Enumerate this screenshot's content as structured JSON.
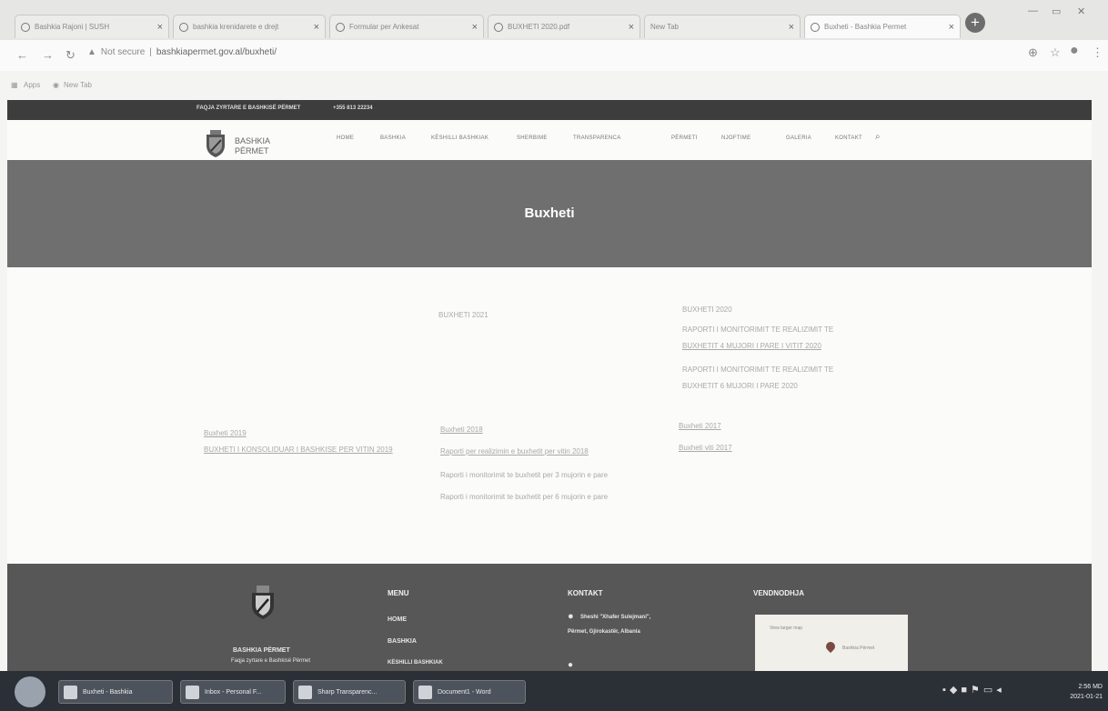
{
  "browser": {
    "tabs": [
      {
        "title": "Bashkia Rajoni | SUSH"
      },
      {
        "title": "bashkia krenidarete e drejt"
      },
      {
        "title": "Formular per Ankesat"
      },
      {
        "title": "BUXHETI 2020.pdf"
      },
      {
        "title": "New Tab"
      },
      {
        "title": "Buxheti - Bashkia Permet"
      }
    ],
    "new_tab": "+",
    "address": {
      "security": "Not secure",
      "url": "bashkiapermet.gov.al/buxheti/"
    },
    "bookmarks": [
      "Apps",
      "New Tab"
    ]
  },
  "site": {
    "topbar": {
      "org": "FAQJA ZYRTARE E BASHKISË PËRMET",
      "phone": "+355 813 22234"
    },
    "brand": {
      "line1": "BASHKIA",
      "line2": "PËRMET"
    },
    "nav": [
      "HOME",
      "BASHKIA",
      "KËSHILLI BASHKIAK",
      "SHERBIME",
      "TRANSPARENCA",
      "PËRMETI",
      "NJOFTIME",
      "GALERIA",
      "KONTAKT"
    ],
    "hero_title": "Buxheti",
    "content": {
      "col2_top": "BUXHETI 2021",
      "col3_top": "BUXHETI 2020",
      "col3_links": [
        "RAPORTI I MONITORIMIT TE REALIZIMIT TE",
        "BUXHETIT 4 MUJORI I PARE I VITIT 2020",
        "RAPORTI I MONITORIMIT TE REALIZIMIT TE",
        "BUXHETIT 6 MUJORI I PARE 2020"
      ],
      "col1_row": [
        "Buxheti 2019",
        "BUXHETI I KONSOLIDUAR I BASHKISE PER VITIN 2019"
      ],
      "col2_row": [
        "Buxheti 2018",
        "Raporti per realizimin e buxhetit per vitin 2018",
        "Raporti i monitorimit te buxhetit per 3 mujorin e pare",
        "Raporti i monitorimit te buxhetit per 6 mujorin e pare"
      ],
      "col3_row": [
        "Buxheti 2017",
        "Buxheti viti 2017"
      ]
    },
    "footer": {
      "brand": "BASHKIA PËRMET",
      "tagline": "Faqja zyrtare e Bashkisë Përmet",
      "menu_title": "MENU",
      "menu": [
        "HOME",
        "BASHKIA",
        "KËSHILLI BASHKIAK"
      ],
      "contact_title": "KONTAKT",
      "contact_address_line1": "Sheshi \"Xhafer Sulejmani\",",
      "contact_address_line2": "Përmet, Gjirokastër, Albania",
      "location_title": "VENDNODHJA",
      "map_caption": "View larger map",
      "map_label": "Bashkia Përmet"
    }
  },
  "taskbar": {
    "buttons": [
      "Buxheti - Bashkia",
      "Inbox - Personal F...",
      "Sharp Transparenc...",
      "Document1 - Word"
    ],
    "time": "2:56 MD",
    "date": "2021-01-21"
  }
}
